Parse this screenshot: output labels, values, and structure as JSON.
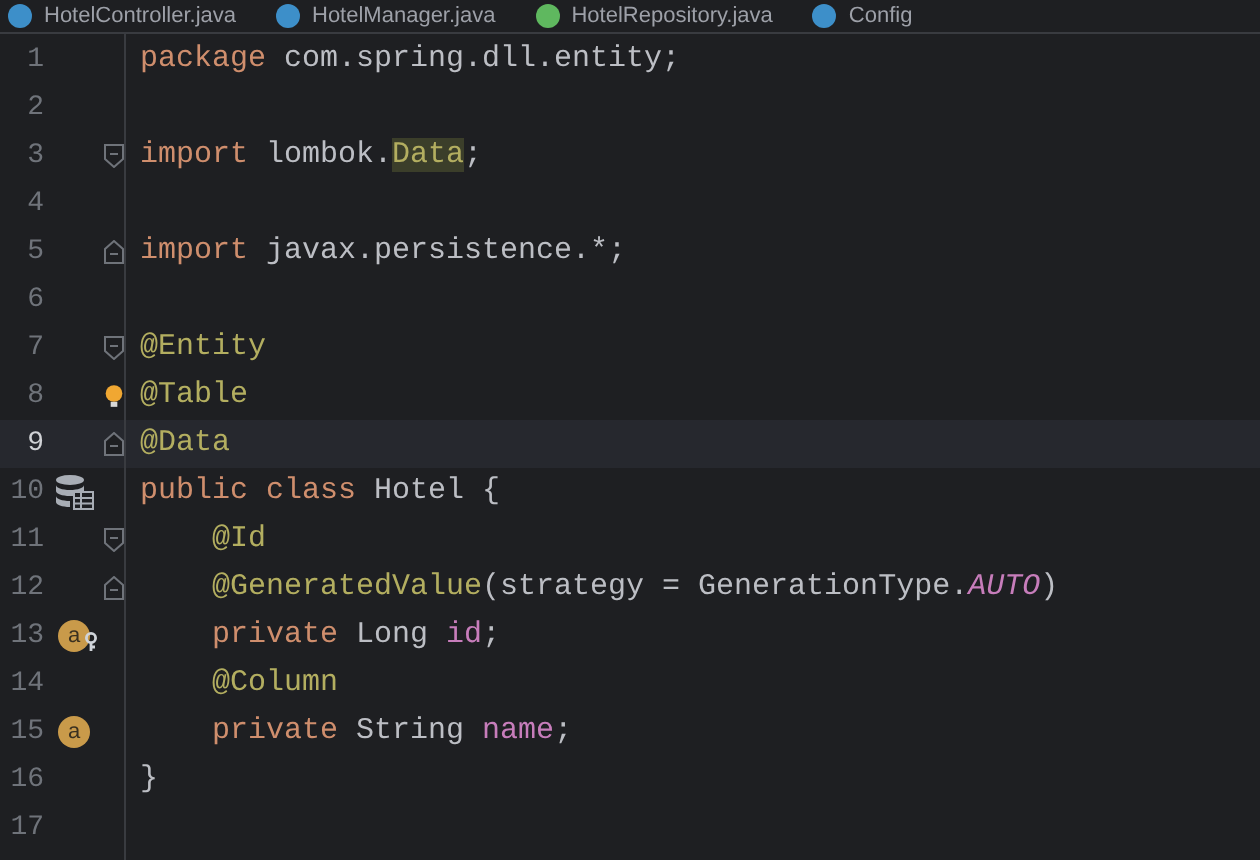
{
  "tabs": [
    {
      "label": "HotelController.java",
      "kind": "class",
      "selected": false
    },
    {
      "label": "HotelManager.java",
      "kind": "class",
      "selected": false
    },
    {
      "label": "HotelRepository.java",
      "kind": "interface",
      "selected": false
    },
    {
      "label": "Config",
      "kind": "class",
      "selected": false
    }
  ],
  "lines": [
    {
      "number": "1",
      "current": false,
      "tokens": [
        {
          "kind": "keyword",
          "text": "package"
        },
        {
          "kind": "plain",
          "text": " com.spring.dll.entity;"
        }
      ]
    },
    {
      "number": "2",
      "current": false
    },
    {
      "number": "3",
      "current": false,
      "fold": {
        "kind": "start"
      },
      "tokens": [
        {
          "kind": "keyword",
          "text": "import"
        },
        {
          "kind": "plain",
          "text": " lombok."
        },
        {
          "kind": "highlight",
          "text": "Data"
        },
        {
          "kind": "plain",
          "text": ";"
        }
      ]
    },
    {
      "number": "4",
      "current": false
    },
    {
      "number": "5",
      "current": false,
      "fold": {
        "kind": "end"
      },
      "tokens": [
        {
          "kind": "keyword",
          "text": "import"
        },
        {
          "kind": "plain",
          "text": " javax.persistence.*;"
        }
      ]
    },
    {
      "number": "6",
      "current": false
    },
    {
      "number": "7",
      "current": false,
      "fold": {
        "kind": "start"
      },
      "tokens": [
        {
          "kind": "annotation",
          "text": "@Entity"
        }
      ]
    },
    {
      "number": "8",
      "current": false,
      "bulb": true,
      "tokens": [
        {
          "kind": "annotation",
          "text": "@Table"
        }
      ]
    },
    {
      "number": "9",
      "current": true,
      "fold": {
        "kind": "end"
      },
      "tokens": [
        {
          "kind": "annotation",
          "text": "@Data"
        }
      ]
    },
    {
      "number": "10",
      "current": false,
      "gutter": {
        "kind": "entity"
      },
      "tokens": [
        {
          "kind": "keyword",
          "text": "public class"
        },
        {
          "kind": "plain",
          "text": " Hotel {"
        }
      ]
    },
    {
      "number": "11",
      "current": false,
      "fold": {
        "kind": "start"
      },
      "tokens": [
        {
          "kind": "annotation",
          "text": "    @Id"
        }
      ]
    },
    {
      "number": "12",
      "current": false,
      "fold": {
        "kind": "end"
      },
      "tokens": [
        {
          "kind": "annotation",
          "text": "    @GeneratedValue"
        },
        {
          "kind": "plain",
          "text": "(strategy = GenerationType."
        },
        {
          "kind": "constant",
          "text": "AUTO"
        },
        {
          "kind": "plain",
          "text": ")"
        }
      ]
    },
    {
      "number": "13",
      "current": false,
      "gutter": {
        "kind": "key-field",
        "label": "a"
      },
      "tokens": [
        {
          "kind": "keyword",
          "text": "    private"
        },
        {
          "kind": "plain",
          "text": " Long "
        },
        {
          "kind": "field",
          "text": "id"
        },
        {
          "kind": "plain",
          "text": ";"
        }
      ]
    },
    {
      "number": "14",
      "current": false,
      "tokens": [
        {
          "kind": "annotation",
          "text": "    @Column"
        }
      ]
    },
    {
      "number": "15",
      "current": false,
      "gutter": {
        "kind": "field",
        "label": "a"
      },
      "tokens": [
        {
          "kind": "keyword",
          "text": "    private"
        },
        {
          "kind": "plain",
          "text": " String "
        },
        {
          "kind": "field",
          "text": "name"
        },
        {
          "kind": "plain",
          "text": ";"
        }
      ]
    },
    {
      "number": "16",
      "current": false,
      "tokens": [
        {
          "kind": "plain",
          "text": "}"
        }
      ]
    },
    {
      "number": "17",
      "current": false
    }
  ]
}
